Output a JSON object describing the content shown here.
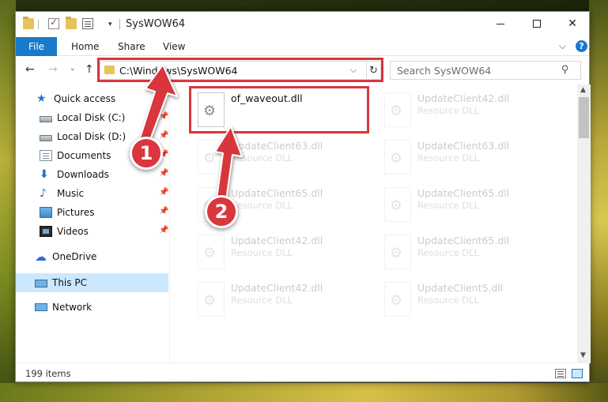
{
  "window": {
    "title": "SysWOW64",
    "controls": {
      "minimize": "minimize",
      "maximize": "maximize",
      "close": "✕"
    }
  },
  "ribbon": {
    "tabs": [
      "File",
      "Home",
      "Share",
      "View"
    ],
    "help_symbol": "?",
    "collapse_symbol": "⌵"
  },
  "address": {
    "path": "C:\\Windows\\SysWOW64",
    "dropdown_symbol": "⌵",
    "refresh_symbol": "↻"
  },
  "search": {
    "placeholder": "Search SysWOW64"
  },
  "nav": {
    "back": "←",
    "forward": "→",
    "recent": "⌄",
    "up": "↑"
  },
  "sidebar": {
    "items": [
      {
        "label": "Quick access",
        "icon": "star-icon"
      },
      {
        "label": "Local Disk (C:)",
        "icon": "disk-icon",
        "pinned": true
      },
      {
        "label": "Local Disk (D:)",
        "icon": "disk-icon",
        "pinned": true
      },
      {
        "label": "Documents",
        "icon": "documents-icon",
        "pinned": true
      },
      {
        "label": "Downloads",
        "icon": "downloads-icon",
        "pinned": true
      },
      {
        "label": "Music",
        "icon": "music-icon",
        "pinned": true
      },
      {
        "label": "Pictures",
        "icon": "pictures-icon",
        "pinned": true
      },
      {
        "label": "Videos",
        "icon": "videos-icon",
        "pinned": true
      },
      {
        "label": "OneDrive",
        "icon": "onedrive-icon"
      },
      {
        "label": "This PC",
        "icon": "pc-icon",
        "selected": true
      },
      {
        "label": "Network",
        "icon": "network-icon"
      }
    ]
  },
  "files": [
    {
      "name": "of_waveout.dll",
      "type": "",
      "highlighted": true
    },
    {
      "name": "UpdateClient42.dll",
      "type": "Resource DLL"
    },
    {
      "name": "UpdateClient63.dll",
      "type": "Resource DLL"
    },
    {
      "name": "UpdateClient63.dll",
      "type": "Resource DLL"
    },
    {
      "name": "UpdateClient65.dll",
      "type": "Resource DLL"
    },
    {
      "name": "UpdateClient65.dll",
      "type": "Resource DLL"
    },
    {
      "name": "UpdateClient42.dll",
      "type": "Resource DLL"
    },
    {
      "name": "UpdateClient65.dll",
      "type": "Resource DLL"
    },
    {
      "name": "UpdateClient42.dll",
      "type": "Resource DLL"
    },
    {
      "name": "UpdateClient5.dll",
      "type": "Resource DLL"
    }
  ],
  "status": {
    "item_count": "199 items"
  },
  "annotations": {
    "step1": "1",
    "step2": "2",
    "color": "#d9363e"
  },
  "colors": {
    "accent": "#1979ca",
    "selection": "#cce8ff",
    "highlight": "#d9363e"
  }
}
